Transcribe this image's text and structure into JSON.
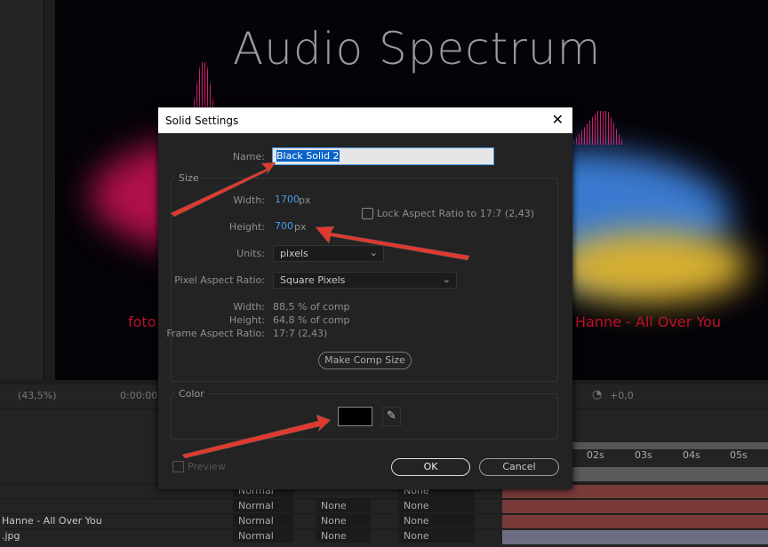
{
  "viewer": {
    "title": "Audio Spectrum",
    "left_caption": "foto",
    "right_caption": "Hanne - All Over You"
  },
  "toolbar": {
    "zoom": "(43,5%)",
    "timecode": "0:00:00:0",
    "exposure": "+0,0"
  },
  "timeline": {
    "ticks": [
      "02s",
      "03s",
      "04s",
      "05s"
    ],
    "layers": [
      {
        "name": "",
        "mode": "Normal",
        "track": "",
        "parent": "None"
      },
      {
        "name": "",
        "mode": "Normal",
        "track": "None",
        "parent": "None"
      },
      {
        "name": "Hanne - All Over You",
        "mode": "Normal",
        "track": "None",
        "parent": "None"
      },
      {
        "name": ".jpg",
        "mode": "Normal",
        "track": "None",
        "parent": "None"
      }
    ]
  },
  "dialog": {
    "title": "Solid Settings",
    "name_label": "Name:",
    "name_value": "Black Solid 2",
    "size_legend": "Size",
    "width_label": "Width:",
    "width_value": "1700",
    "width_unit": "px",
    "height_label": "Height:",
    "height_value": "700",
    "height_unit": "px",
    "lock_label": "Lock Aspect Ratio to 17:7 (2,43)",
    "lock_checked": false,
    "units_label": "Units:",
    "units_value": "pixels",
    "par_label": "Pixel Aspect Ratio:",
    "par_value": "Square Pixels",
    "info_width_label": "Width:",
    "info_width": "88,5 % of comp",
    "info_height_label": "Height:",
    "info_height": "64,8 % of comp",
    "info_far_label": "Frame Aspect Ratio:",
    "info_far": "17:7 (2,43)",
    "make_comp_size": "Make Comp Size",
    "color_legend": "Color",
    "color_value": "#000000",
    "preview_label": "Preview",
    "ok": "OK",
    "cancel": "Cancel"
  },
  "colors": {
    "arrow": "#e03a2f",
    "accent": "#4a9ce8"
  }
}
